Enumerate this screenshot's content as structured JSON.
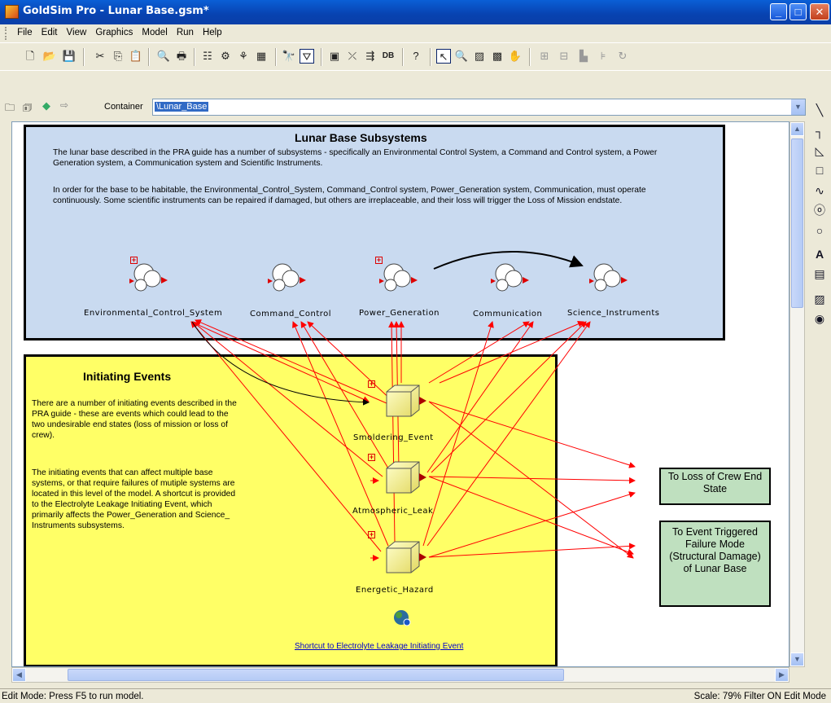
{
  "window": {
    "title": "GoldSim Pro - Lunar Base.gsm*"
  },
  "menu": [
    "File",
    "Edit",
    "View",
    "Graphics",
    "Model",
    "Run",
    "Help"
  ],
  "container_bar": {
    "label": "Container",
    "value": "\\Lunar_Base"
  },
  "subsystems_box": {
    "title": "Lunar Base Subsystems",
    "para1": "The lunar base described in the PRA guide has a number of subsystems - specifically an Environmental Control System, a Command and Control system, a Power Generation system, a Communication system and Scientific Instruments.",
    "para2": "In order for the base to be habitable, the Environmental_Control_System, Command_Control system, Power_Generation system, Communication, must operate continuously.   Some scientific instruments can be repaired if damaged, but others are irreplaceable, and their loss will trigger the Loss of Mission endstate.",
    "nodes": [
      "Environmental_Control_System",
      "Command_Control",
      "Power_Generation",
      "Communication",
      "Science_Instruments"
    ]
  },
  "events_box": {
    "title": "Initiating Events",
    "para1": "There are a number of initiating events described in the PRA guide - these are events which could lead to the two undesirable end states (loss of mission or loss of crew).",
    "para2": "The initiating events that can affect multiple base systems, or that require failures of mutiple systems are located in this level of the model.  A shortcut is provided to the Electrolyte Leakage Initiating Event, which primarily affects the Power_Generation and Science_ Instruments subsystems.",
    "nodes": [
      "Smoldering_Event",
      "Atmospheric_Leak",
      "Energetic_Hazard"
    ],
    "shortcut": "Shortcut to Electrolyte Leakage Initiating Event"
  },
  "end_states": {
    "crew": "To Loss of Crew End State",
    "event": "To Event Triggered Failure Mode (Structural Damage) of Lunar Base"
  },
  "status": {
    "left": "Edit Mode: Press F5 to run model.",
    "right": "Scale: 79%   Filter ON   Edit Mode"
  },
  "toolbar": {
    "db": "DB"
  },
  "colors": {
    "subsystem_bg": "#c9daf0",
    "events_bg": "#ffff66",
    "end_state_bg": "#bfe0bf",
    "arrow": "#ff0000"
  }
}
